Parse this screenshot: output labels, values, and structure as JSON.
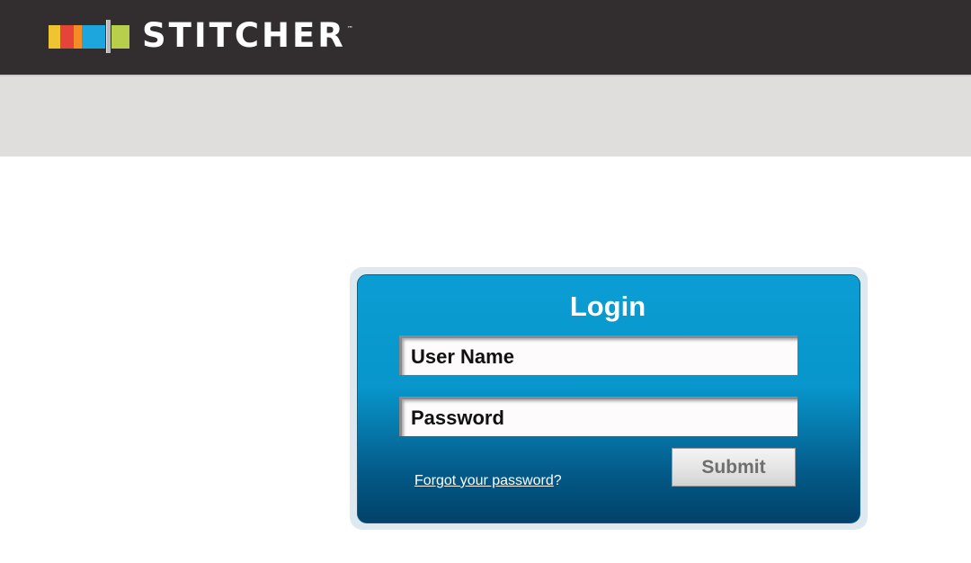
{
  "header": {
    "logo_text": "STITCHER",
    "logo_tm": "™",
    "logo_colors": [
      "#f0c330",
      "#e4443a",
      "#f58b24",
      "#1ba7dd",
      "#b7cf4a"
    ]
  },
  "login": {
    "title": "Login",
    "username_placeholder": "User Name",
    "password_placeholder": "Password",
    "forgot_link": "Forgot your password",
    "forgot_suffix": "?",
    "submit_label": "Submit"
  }
}
